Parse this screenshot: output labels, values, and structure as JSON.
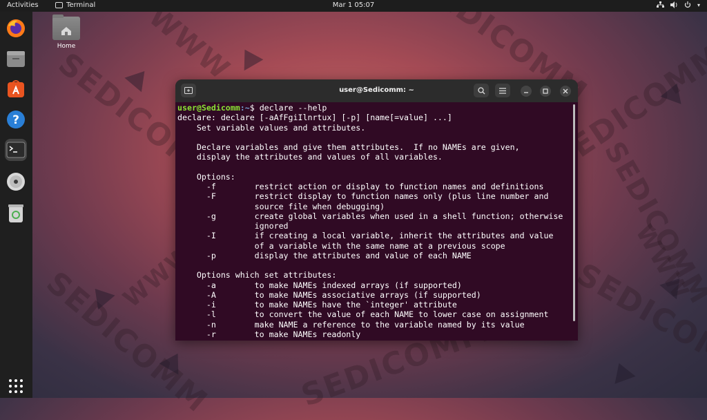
{
  "topbar": {
    "activities": "Activities",
    "app_name": "Terminal",
    "datetime": "Mar 1  05:07",
    "tray_icons": [
      "network-icon",
      "volume-icon",
      "power-icon"
    ]
  },
  "dock": {
    "items": [
      "firefox-icon",
      "files-icon",
      "software-icon",
      "help-icon",
      "terminal-icon",
      "disc-icon",
      "trash-icon",
      "app-grid-icon"
    ]
  },
  "desktop": {
    "home_label": "Home"
  },
  "wallpaper": {
    "watermark_text": "SEDICOMM",
    "watermark_url": "WWW"
  },
  "terminal": {
    "title": "user@Sedicomm: ~",
    "prompt_user": "user@Sedicomm",
    "prompt_path": ":~",
    "prompt_symbol": "$ ",
    "command": "declare --help",
    "output": [
      "declare: declare [-aAfFgiIlnrtux] [-p] [name[=value] ...]",
      "    Set variable values and attributes.",
      "",
      "    Declare variables and give them attributes.  If no NAMEs are given,",
      "    display the attributes and values of all variables.",
      "",
      "    Options:",
      "      -f        restrict action or display to function names and definitions",
      "      -F        restrict display to function names only (plus line number and",
      "                source file when debugging)",
      "      -g        create global variables when used in a shell function; otherwise",
      "                ignored",
      "      -I        if creating a local variable, inherit the attributes and value",
      "                of a variable with the same name at a previous scope",
      "      -p        display the attributes and value of each NAME",
      "",
      "    Options which set attributes:",
      "      -a        to make NAMEs indexed arrays (if supported)",
      "      -A        to make NAMEs associative arrays (if supported)",
      "      -i        to make NAMEs have the `integer' attribute",
      "      -l        to convert the value of each NAME to lower case on assignment",
      "      -n        make NAME a reference to the variable named by its value",
      "      -r        to make NAMEs readonly"
    ]
  },
  "colors": {
    "terminal_bg": "#300a24",
    "prompt_user": "#8ae234",
    "prompt_path": "#729fcf"
  }
}
